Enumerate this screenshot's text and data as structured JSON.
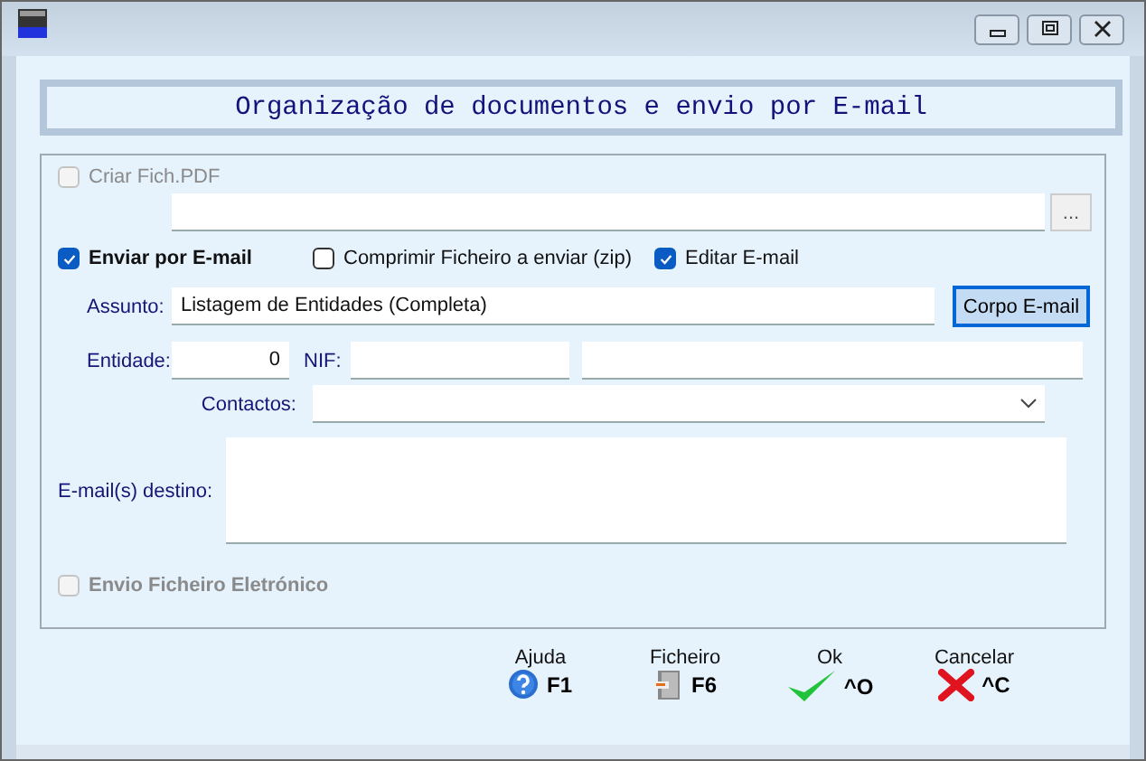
{
  "heading": "Organização de documentos e envio por E-mail",
  "pdf": {
    "label": "Criar Fich.PDF",
    "checked": false,
    "disabled": true
  },
  "pdf_browse": "...",
  "email_options": [
    {
      "label": "Enviar por E-mail",
      "checked": true,
      "bold": true
    },
    {
      "label": "Comprimir Ficheiro a enviar  (zip)",
      "checked": false,
      "bold": false
    },
    {
      "label": "Editar E-mail",
      "checked": true,
      "bold": false
    }
  ],
  "subject": {
    "label": "Assunto:",
    "value": "Listagem de Entidades (Completa)"
  },
  "body_button": "Corpo E-mail",
  "entity": {
    "label": "Entidade:",
    "value": "0"
  },
  "nif": {
    "label": "NIF:"
  },
  "contacts": {
    "label": "Contactos:"
  },
  "recipients": {
    "label": "E-mail(s) destino:"
  },
  "electronic": {
    "label": "Envio Ficheiro Eletrónico",
    "checked": false,
    "disabled": true
  },
  "toolbar": [
    {
      "kind": "help",
      "label": "Ajuda",
      "key": "F1"
    },
    {
      "kind": "file",
      "label": "Ficheiro",
      "key": "F6"
    },
    {
      "kind": "ok",
      "label": "Ok",
      "key": "^O"
    },
    {
      "kind": "cancel",
      "label": "Cancelar",
      "key": "^C"
    }
  ]
}
